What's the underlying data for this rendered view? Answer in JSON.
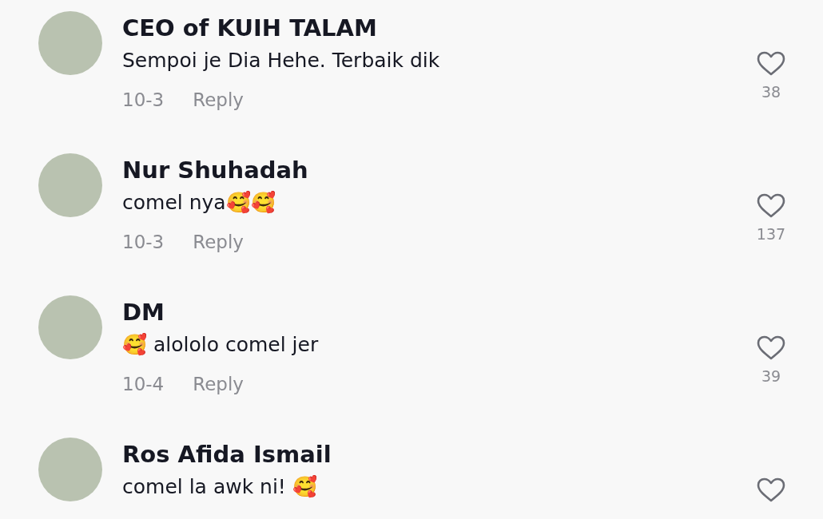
{
  "comments": [
    {
      "name": "CEO of KUIH TALAM",
      "text": "Sempoi je Dia Hehe. Terbaik dik",
      "date": "10-3",
      "reply": "Reply",
      "likes": "38"
    },
    {
      "name": "Nur Shuhadah",
      "text": "comel nya🥰🥰",
      "date": "10-3",
      "reply": "Reply",
      "likes": "137"
    },
    {
      "name": "DM",
      "text": "🥰 alololo comel jer",
      "date": "10-4",
      "reply": "Reply",
      "likes": "39"
    },
    {
      "name": "Ros Afida Ismail",
      "text": "comel la awk ni! 🥰"
    }
  ]
}
